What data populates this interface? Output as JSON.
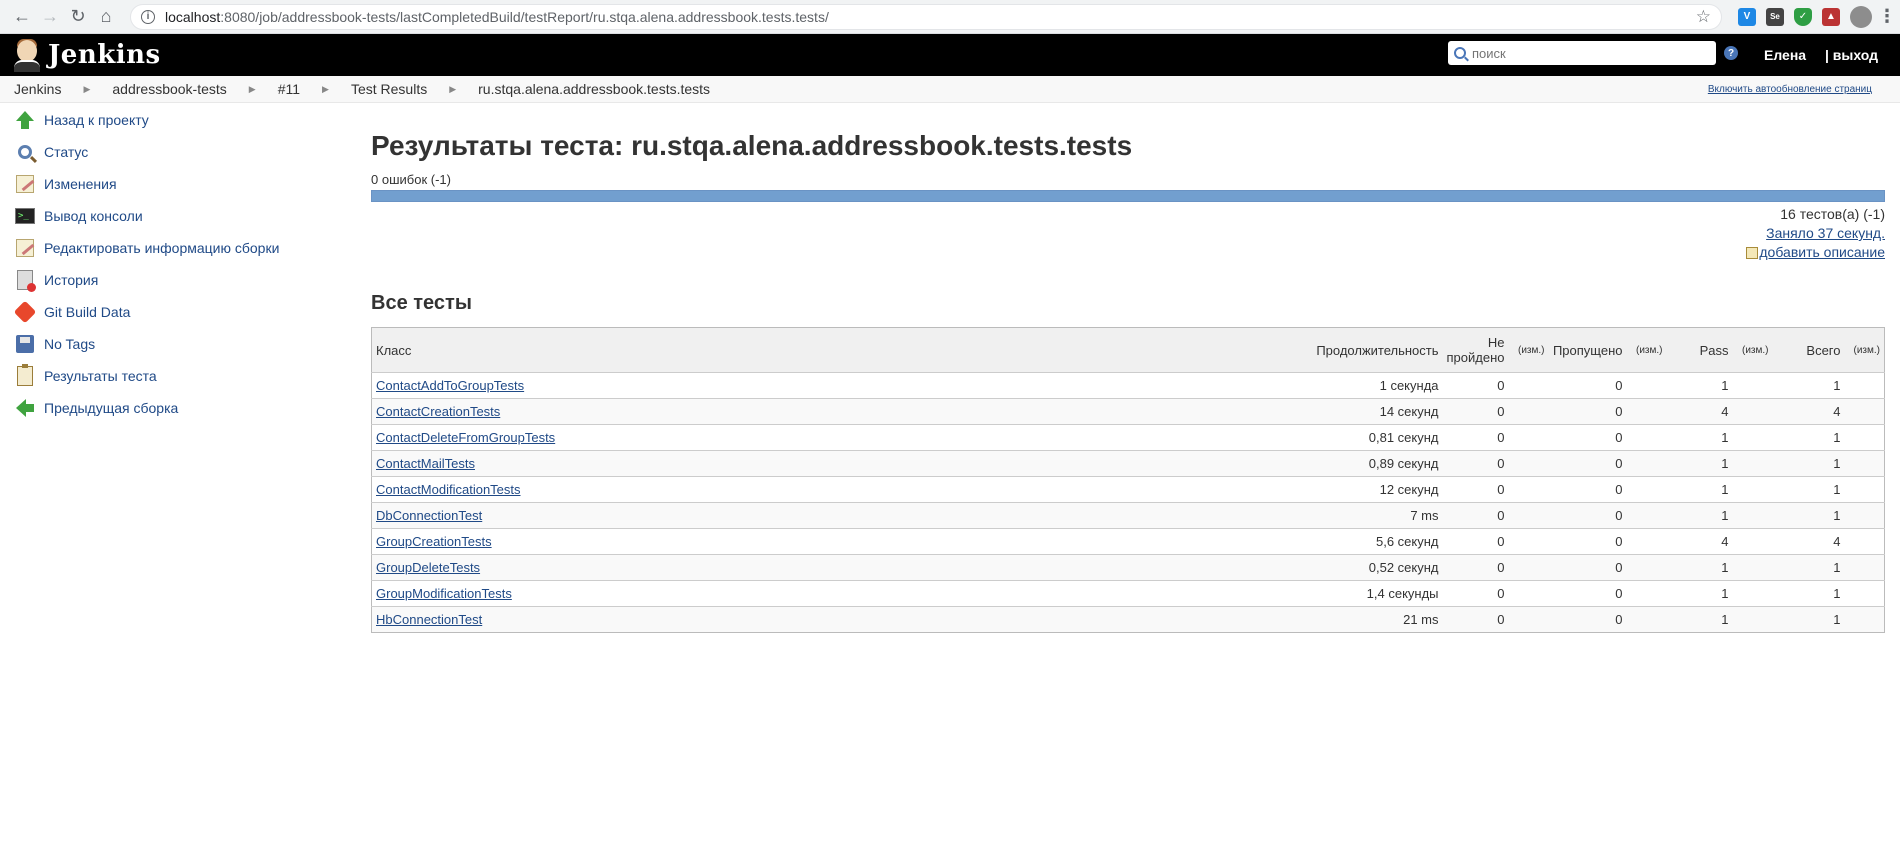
{
  "browser": {
    "url_host": "localhost",
    "url_path": ":8080/job/addressbook-tests/lastCompletedBuild/testReport/ru.stqa.alena.addressbook.tests.tests/"
  },
  "header": {
    "brand": "Jenkins",
    "search_placeholder": "поиск",
    "help": "?",
    "user": "Елена",
    "logout": "| выход"
  },
  "breadcrumbs": [
    {
      "label": "Jenkins"
    },
    {
      "label": "addressbook-tests"
    },
    {
      "label": "#11"
    },
    {
      "label": "Test Results"
    },
    {
      "label": "ru.stqa.alena.addressbook.tests.tests"
    }
  ],
  "autorefresh": "Включить автообновление страниц",
  "sidebar": [
    {
      "label": "Назад к проекту",
      "icon": "up-arrow-icon"
    },
    {
      "label": "Статус",
      "icon": "magnifier-icon"
    },
    {
      "label": "Изменения",
      "icon": "notepad-icon"
    },
    {
      "label": "Вывод консоли",
      "icon": "terminal-icon"
    },
    {
      "label": "Редактировать информацию сборки",
      "icon": "notepad-icon"
    },
    {
      "label": "История",
      "icon": "history-icon"
    },
    {
      "label": "Git Build Data",
      "icon": "git-icon"
    },
    {
      "label": "No Tags",
      "icon": "floppy-icon"
    },
    {
      "label": "Результаты теста",
      "icon": "clipboard-icon"
    },
    {
      "label": "Предыдущая сборка",
      "icon": "left-arrow-icon"
    }
  ],
  "main": {
    "title": "Результаты теста: ru.stqa.alena.addressbook.tests.tests",
    "failures": "0 ошибок (-1)",
    "tests_count": "16 тестов(а) (-1)",
    "duration": "Заняло 37 секунд.",
    "add_description": "добавить описание",
    "section_title": "Все тесты"
  },
  "table": {
    "headers": {
      "class": "Класс",
      "duration": "Продолжительность",
      "failed": "Не пройдено",
      "change": "(изм.)",
      "skipped": "Пропущено",
      "pass": "Pass",
      "total": "Всего"
    },
    "rows": [
      {
        "class": "ContactAddToGroupTests",
        "duration": "1 секунда",
        "failed": "0",
        "skipped": "0",
        "pass": "1",
        "total": "1"
      },
      {
        "class": "ContactCreationTests",
        "duration": "14 секунд",
        "failed": "0",
        "skipped": "0",
        "pass": "4",
        "total": "4"
      },
      {
        "class": "ContactDeleteFromGroupTests",
        "duration": "0,81 секунд",
        "failed": "0",
        "skipped": "0",
        "pass": "1",
        "total": "1"
      },
      {
        "class": "ContactMailTests",
        "duration": "0,89 секунд",
        "failed": "0",
        "skipped": "0",
        "pass": "1",
        "total": "1"
      },
      {
        "class": "ContactModificationTests",
        "duration": "12 секунд",
        "failed": "0",
        "skipped": "0",
        "pass": "1",
        "total": "1"
      },
      {
        "class": "DbConnectionTest",
        "duration": "7 ms",
        "failed": "0",
        "skipped": "0",
        "pass": "1",
        "total": "1"
      },
      {
        "class": "GroupCreationTests",
        "duration": "5,6 секунд",
        "failed": "0",
        "skipped": "0",
        "pass": "4",
        "total": "4"
      },
      {
        "class": "GroupDeleteTests",
        "duration": "0,52 секунд",
        "failed": "0",
        "skipped": "0",
        "pass": "1",
        "total": "1"
      },
      {
        "class": "GroupModificationTests",
        "duration": "1,4 секунды",
        "failed": "0",
        "skipped": "0",
        "pass": "1",
        "total": "1"
      },
      {
        "class": "HbConnectionTest",
        "duration": "21 ms",
        "failed": "0",
        "skipped": "0",
        "pass": "1",
        "total": "1"
      }
    ]
  },
  "colors": {
    "header_bg": "#000000",
    "link": "#204a87",
    "progress_bar": "#729fcf"
  }
}
